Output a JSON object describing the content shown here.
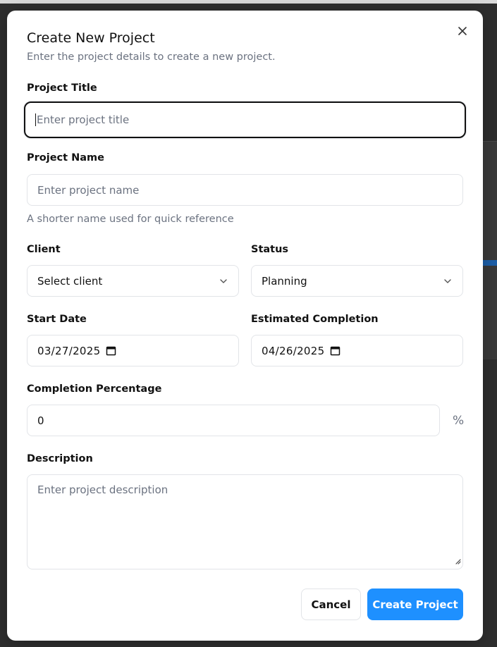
{
  "modal": {
    "title": "Create New Project",
    "subtitle": "Enter the project details to create a new project.",
    "close_icon": "close-icon"
  },
  "form": {
    "project_title": {
      "label": "Project Title",
      "placeholder": "Enter project title",
      "value": ""
    },
    "project_name": {
      "label": "Project Name",
      "placeholder": "Enter project name",
      "value": "",
      "helper": "A shorter name used for quick reference"
    },
    "client": {
      "label": "Client",
      "selected": "Select client",
      "icon": "chevron-down-icon"
    },
    "status": {
      "label": "Status",
      "selected": "Planning",
      "icon": "chevron-down-icon"
    },
    "start_date": {
      "label": "Start Date",
      "value": "03/27/2025",
      "icon": "calendar-icon"
    },
    "estimated_completion": {
      "label": "Estimated Completion",
      "value": "04/26/2025",
      "icon": "calendar-icon"
    },
    "completion_percentage": {
      "label": "Completion Percentage",
      "value": "0",
      "unit": "%"
    },
    "description": {
      "label": "Description",
      "placeholder": "Enter project description",
      "value": ""
    }
  },
  "actions": {
    "cancel_label": "Cancel",
    "create_label": "Create Project"
  },
  "colors": {
    "primary": "#1e90ff",
    "overlay": "#2e2e2e",
    "muted_text": "#6b7280",
    "border": "#e2e4e8"
  }
}
